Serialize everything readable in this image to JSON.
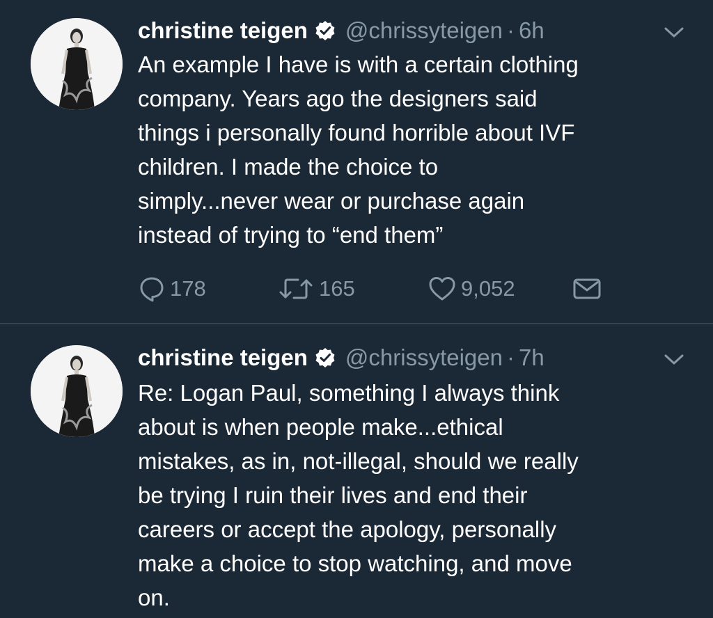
{
  "colors": {
    "background": "#1b2836",
    "text_primary": "#ffffff",
    "text_secondary": "#8899a6",
    "divider": "#38444d"
  },
  "tweets": [
    {
      "author": {
        "name": "christine teigen",
        "handle": "@chrissyteigen",
        "verified": true,
        "avatar_icon": "profile-photo"
      },
      "separator": "·",
      "time": "6h",
      "text_lines": [
        "An example I have is with a certain clothing",
        "company. Years ago the designers said",
        "things i personally found horrible about IVF",
        "children. I made the choice to",
        "simply...never wear or purchase again",
        "instead of trying to “end them”"
      ],
      "actions": {
        "reply_icon": "reply-icon",
        "reply_count": "178",
        "retweet_icon": "retweet-icon",
        "retweet_count": "165",
        "like_icon": "heart-icon",
        "like_count": "9,052",
        "dm_icon": "envelope-icon"
      }
    },
    {
      "author": {
        "name": "christine teigen",
        "handle": "@chrissyteigen",
        "verified": true,
        "avatar_icon": "profile-photo"
      },
      "separator": "·",
      "time": "7h",
      "text_lines": [
        "Re: Logan Paul, something I always think",
        "about is when people make...ethical",
        "mistakes, as in, not-illegal, should we really",
        "be trying I ruin their lives and end their",
        "careers or accept the apology, personally",
        "make a choice to stop watching, and move",
        "on."
      ]
    }
  ]
}
